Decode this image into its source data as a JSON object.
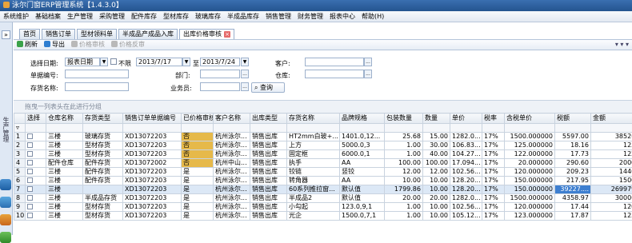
{
  "app": {
    "title": "泳尔门窗ERP管理系统【1.4.3.0】"
  },
  "menu": [
    "系统维护",
    "基础档案",
    "生产管理",
    "采购管理",
    "配件库存",
    "型材库存",
    "玻璃库存",
    "半成品库存",
    "销售管理",
    "财务管理",
    "报表中心",
    "帮助(H)"
  ],
  "sidebar": {
    "collapse": "»",
    "label": "生产管理"
  },
  "tabs": [
    {
      "label": "首页",
      "active": false
    },
    {
      "label": "销售订单",
      "active": false
    },
    {
      "label": "型材领料单",
      "active": false
    },
    {
      "label": "半成品产成品入库",
      "active": false
    },
    {
      "label": "出库价格审核",
      "active": true
    }
  ],
  "toolbar": {
    "refresh": "刷新",
    "export": "导出",
    "audit": "价格审核",
    "unaudit": "价格反审",
    "right_icons": "▾ ▾ ▾"
  },
  "filters": {
    "date_label": "选择日期:",
    "date_type": "报表日期",
    "unlimited_label": "不限",
    "date_from": "2013/7/17",
    "to_label": "至",
    "date_to": "2013/7/24",
    "customer_label": "客户:",
    "order_no_label": "单据编号:",
    "dept_label": "部门:",
    "warehouse_label": "仓库:",
    "stock_name_label": "存货名称:",
    "clerk_label": "业务员:",
    "query_button": "查询",
    "ellipsis": "..."
  },
  "group_hint": "拖曳一列表头在此进行分组",
  "table": {
    "columns": [
      "",
      "选择",
      "仓库名称",
      "存货类型",
      "销售订单单据编号",
      "已价格审核",
      "客户名称",
      "出库类型",
      "存货名称",
      "品牌规格",
      "包装数量",
      "数量",
      "单价",
      "税率",
      "含税单价",
      "税额",
      "金额"
    ],
    "filter_marker": "▿",
    "rows": [
      [
        "1",
        "",
        "三楼",
        "玻璃存货",
        "XD13072203",
        "否",
        "杭州泳尔...",
        "销售出库",
        "HT2mm白玻+...",
        "1401.0,12...",
        "25.68",
        "15.00",
        "1282.0...",
        "17%",
        "1500.000000",
        "5597.00",
        "38520.50"
      ],
      [
        "2",
        "",
        "三楼",
        "型材存货",
        "XD13072203",
        "否",
        "杭州泳尔...",
        "销售出库",
        "上方",
        "5000.0,3",
        "1.00",
        "30.00",
        "106.83...",
        "17%",
        "125.000000",
        "18.16",
        "125.00"
      ],
      [
        "3",
        "",
        "三楼",
        "型材存货",
        "XD13072203",
        "否",
        "杭州泳尔...",
        "销售出库",
        "固定框",
        "6000.0,1",
        "1.00",
        "40.00",
        "104.27...",
        "17%",
        "122.000000",
        "17.73",
        "122.00"
      ],
      [
        "4",
        "",
        "配件仓库",
        "配件存货",
        "XD13072002",
        "否",
        "杭州中山...",
        "销售出库",
        "执手",
        "AA",
        "100.00",
        "100.00",
        "17.094...",
        "17%",
        "20.000000",
        "290.60",
        "2000.00"
      ],
      [
        "5",
        "",
        "三楼",
        "配件存货",
        "XD13072203",
        "是",
        "杭州泳尔...",
        "销售出库",
        "铰链",
        "竖铰",
        "12.00",
        "12.00",
        "102.56...",
        "17%",
        "120.000000",
        "209.23",
        "1440.00"
      ],
      [
        "6",
        "",
        "三楼",
        "配件存货",
        "XD13072203",
        "是",
        "杭州泳尔...",
        "销售出库",
        "转角器",
        "AA",
        "10.00",
        "10.00",
        "128.20...",
        "17%",
        "150.000000",
        "217.95",
        "1500.00"
      ],
      [
        "7",
        "",
        "三楼",
        "",
        "XD13072203",
        "是",
        "杭州泳尔...",
        "销售出库",
        "60系列推拉窗...",
        "默认值",
        "1799.86",
        "10.00",
        "128.20...",
        "17%",
        "150.000000",
        "39227....",
        "269979.00"
      ],
      [
        "8",
        "",
        "三楼",
        "半成品存货",
        "XD13072203",
        "是",
        "杭州泳尔...",
        "销售出库",
        "半成品2",
        "默认值",
        "20.00",
        "20.00",
        "1282.0...",
        "17%",
        "1500.000000",
        "4358.97",
        "30000.00"
      ],
      [
        "9",
        "",
        "三楼",
        "型材存货",
        "XD13072203",
        "是",
        "杭州泳尔...",
        "销售出库",
        "小勾起",
        "123.0,9,1",
        "1.00",
        "10.00",
        "102.56...",
        "17%",
        "120.000000",
        "17.44",
        "120.00"
      ],
      [
        "10",
        "",
        "三楼",
        "型材存货",
        "XD13072203",
        "是",
        "杭州泳尔...",
        "销售出库",
        "光企",
        "1500.0,7,1",
        "1.00",
        "10.00",
        "105.12...",
        "17%",
        "123.000000",
        "17.87",
        "123.00"
      ]
    ]
  },
  "colors": {
    "unaudited_highlight": "#e6b94a",
    "selected_cell": "#3e7fd0"
  }
}
